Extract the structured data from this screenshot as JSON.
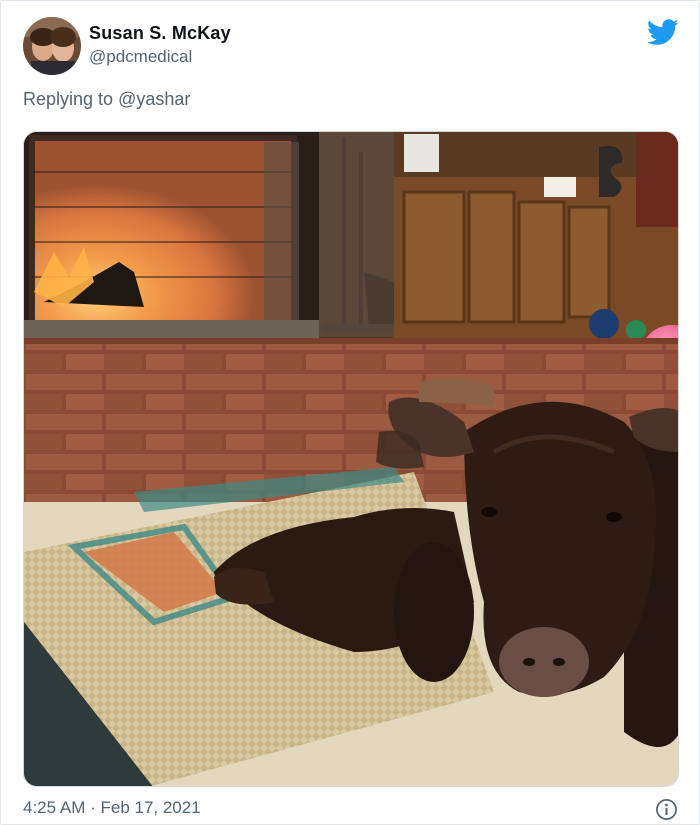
{
  "tweet": {
    "author_name": "Susan S. McKay",
    "author_handle": "@pdcmedical",
    "replying_prefix": "Replying to ",
    "replying_to": "@yashar",
    "timestamp": "4:25 AM · Feb 17, 2021"
  },
  "icons": {
    "brand": "twitter-bird-icon",
    "info": "info-icon"
  },
  "colors": {
    "brand_blue": "#1d9bf0",
    "secondary_text": "#536471",
    "primary_text": "#0f1419"
  }
}
